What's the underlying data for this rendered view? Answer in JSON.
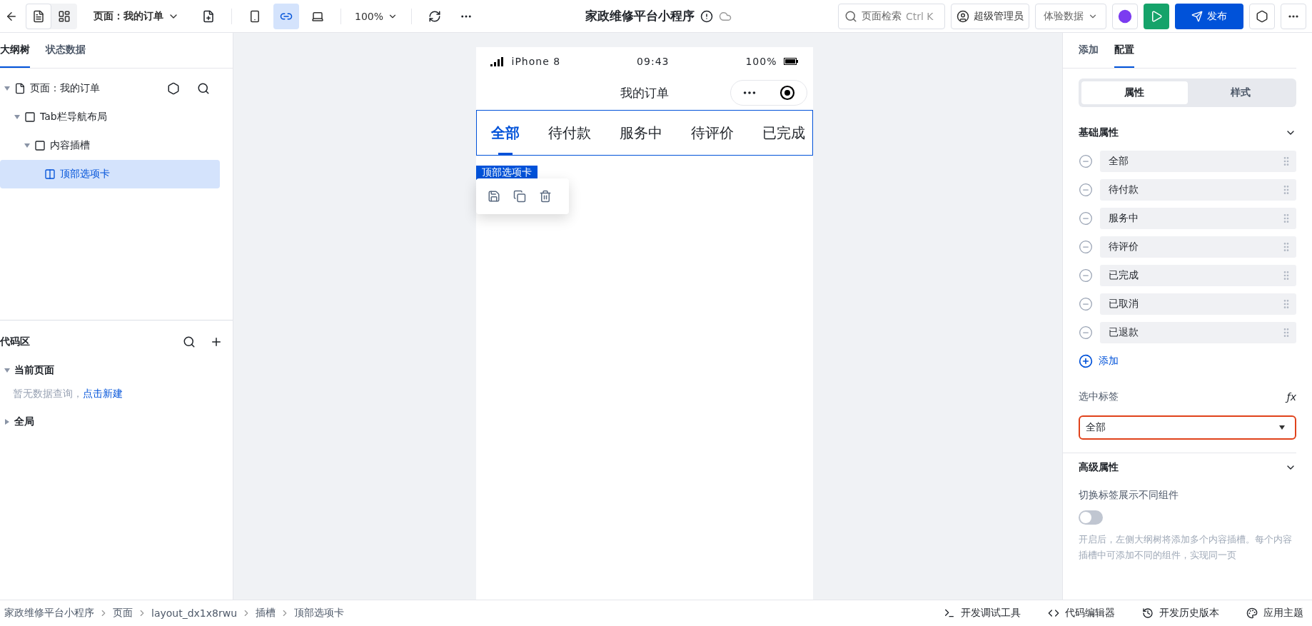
{
  "toolbar": {
    "page_selector": "页面：我的订单",
    "zoom": "100%",
    "devices": [
      {
        "kind": "phone",
        "selected": false
      },
      {
        "kind": "miniapp",
        "selected": true
      },
      {
        "kind": "desktop",
        "selected": false
      }
    ],
    "view_modes": [
      {
        "kind": "outline",
        "selected": true
      },
      {
        "kind": "layout",
        "selected": false
      }
    ],
    "title": "家政维修平台小程序",
    "search": {
      "placeholder": "页面检索",
      "shortcut": "Ctrl K"
    },
    "user": "超级管理员",
    "data_mode": "体验数据",
    "publish": "发布"
  },
  "left_panel": {
    "tabs": [
      {
        "label": "大纲树",
        "selected": true
      },
      {
        "label": "状态数据",
        "selected": false
      }
    ],
    "tree": [
      {
        "label": "页面：我的订单",
        "kind": "page",
        "expanded": true,
        "selected": false,
        "children": [
          {
            "label": "Tab栏导航布局",
            "kind": "frame",
            "expanded": true,
            "selected": false,
            "children": [
              {
                "label": "内容插槽",
                "kind": "frame",
                "expanded": true,
                "selected": false,
                "children": [
                  {
                    "label": "顶部选项卡",
                    "kind": "tabs",
                    "selected": true
                  }
                ]
              }
            ]
          }
        ]
      }
    ],
    "code_area": {
      "title": "代码区",
      "sections": [
        {
          "label": "当前页面",
          "expanded": true,
          "empty_text": "暂无数据查询，",
          "empty_link": "点击新建"
        },
        {
          "label": "全局",
          "expanded": false
        }
      ]
    }
  },
  "phone": {
    "status": {
      "carrier": "iPhone 8",
      "time": "09:43",
      "battery": "100%"
    },
    "nav_title": "我的订单",
    "tabs": [
      {
        "label": "全部",
        "selected": true
      },
      {
        "label": "待付款",
        "selected": false
      },
      {
        "label": "服务中",
        "selected": false
      },
      {
        "label": "待评价",
        "selected": false
      },
      {
        "label": "已完成",
        "selected": false
      }
    ],
    "component_label": "顶部选项卡"
  },
  "right_panel": {
    "tabs": [
      {
        "label": "添加",
        "selected": false
      },
      {
        "label": "配置",
        "selected": true
      }
    ],
    "segments": [
      {
        "label": "属性",
        "selected": true
      },
      {
        "label": "样式",
        "selected": false
      }
    ],
    "basic": {
      "title": "基础属性",
      "expanded": true,
      "items": [
        "全部",
        "待付款",
        "服务中",
        "待评价",
        "已完成",
        "已取消",
        "已退款"
      ],
      "add": "添加",
      "selected_label": "选中标签",
      "formula": "ƒx",
      "selected_value": "全部"
    },
    "advanced": {
      "title": "高级属性",
      "expanded": true,
      "toggle_label": "切换标签展示不同组件",
      "toggle_on": false,
      "description": "开启后，左侧大纲树将添加多个内容插槽。每个内容插槽中可添加不同的组件，实现同一页"
    }
  },
  "breadcrumb": [
    "家政维修平台小程序",
    "页面",
    "layout_dx1x8rwu",
    "插槽",
    "顶部选项卡"
  ],
  "bottom_tools": [
    {
      "kind": "debug",
      "label": "开发调试工具"
    },
    {
      "kind": "code",
      "label": "代码编辑器"
    },
    {
      "kind": "history",
      "label": "开发历史版本"
    },
    {
      "kind": "theme",
      "label": "应用主题"
    }
  ]
}
